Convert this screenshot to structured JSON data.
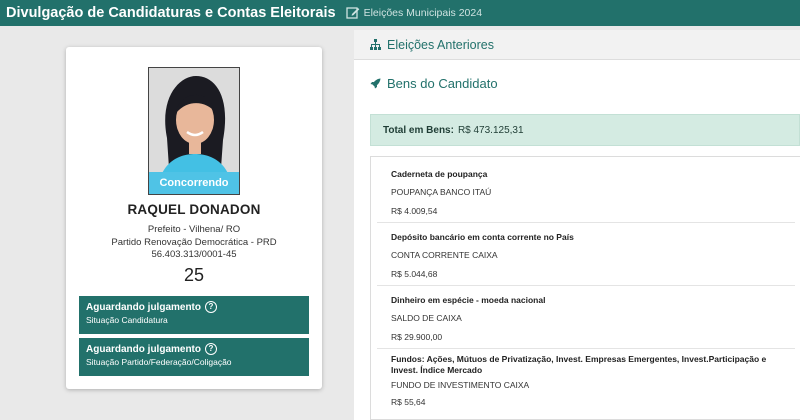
{
  "header": {
    "title": "Divulgação de Candidaturas e Contas Eleitorais",
    "election": "Eleições Municipais 2024"
  },
  "candidate": {
    "photo_status": "Concorrendo",
    "name": "RAQUEL DONADON",
    "office": "Prefeito - Vilhena/ RO",
    "party": "Partido Renovação Democrática - PRD",
    "cnpj": "56.403.313/0001-45",
    "number": "25"
  },
  "statuses": [
    {
      "title": "Aguardando julgamento",
      "subtitle": "Situação Candidatura"
    },
    {
      "title": "Aguardando julgamento",
      "subtitle": "Situação Partido/Federação/Coligação"
    }
  ],
  "right": {
    "previous_elections_label": "Eleições Anteriores",
    "assets_title": "Bens do Candidato",
    "total_label": "Total em Bens:",
    "total_value": "R$ 473.125,31",
    "assets": [
      {
        "type": "Caderneta de poupança",
        "description": "POUPANÇA BANCO ITAÚ",
        "value": "R$ 4.009,54"
      },
      {
        "type": "Depósito bancário em conta corrente no País",
        "description": "CONTA CORRENTE CAIXA",
        "value": "R$ 5.044,68"
      },
      {
        "type": "Dinheiro em espécie - moeda nacional",
        "description": "SALDO DE CAIXA",
        "value": "R$ 29.900,00"
      },
      {
        "type": "Fundos: Ações, Mútuos de Privatização, Invest. Empresas Emergentes, Invest.Participação e Invest. Índice Mercado",
        "description": "FUNDO DE INVESTIMENTO CAIXA",
        "value": "R$ 55,64"
      }
    ]
  },
  "colors": {
    "brand": "#22716b",
    "status_pill": "#4fc3e6",
    "total_bg": "#d4ebe2"
  },
  "icons": {
    "edit": "edit-icon",
    "help": "question-circle-icon",
    "sitemap": "sitemap-icon",
    "rocket": "rocket-icon"
  }
}
